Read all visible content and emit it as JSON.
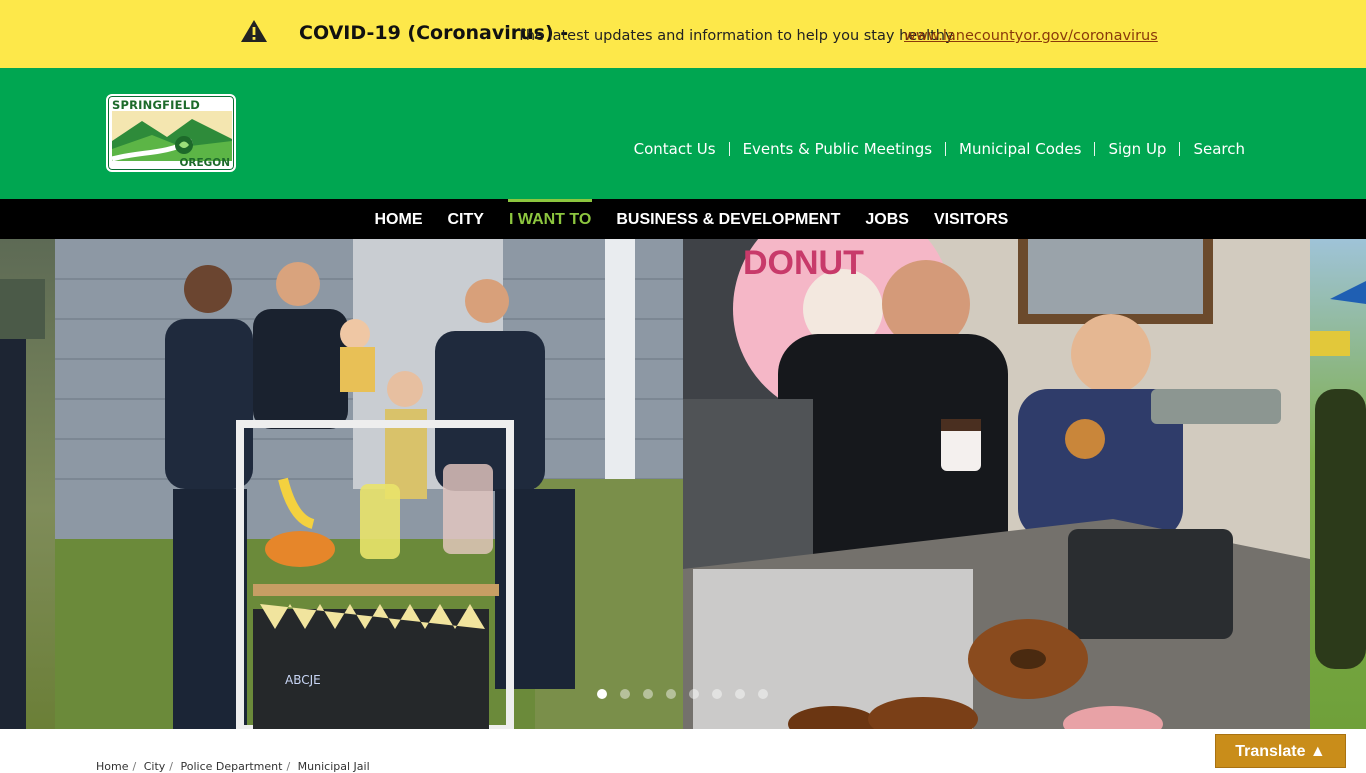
{
  "alert": {
    "icon": "warning-icon",
    "title": "COVID-19 (Coronavirus) -",
    "text": "The latest updates and information to help you stay healthy.",
    "link": "www.lanecountyor.gov/coronavirus",
    "background": "#fde84a"
  },
  "logo": {
    "top_text": "SPRINGFIELD",
    "bottom_text": "OREGON"
  },
  "utility_nav": [
    {
      "label": "Contact Us"
    },
    {
      "label": "Events & Public Meetings"
    },
    {
      "label": "Municipal Codes"
    },
    {
      "label": "Sign Up"
    },
    {
      "label": "Search"
    }
  ],
  "main_nav": [
    {
      "label": "HOME",
      "active": false
    },
    {
      "label": "CITY",
      "active": false
    },
    {
      "label": "I WANT TO",
      "active": true
    },
    {
      "label": "BUSINESS & DEVELOPMENT",
      "active": false
    },
    {
      "label": "JOBS",
      "active": false
    },
    {
      "label": "VISITORS",
      "active": false
    }
  ],
  "slider": {
    "dot_count": 8,
    "active_index": 0
  },
  "breadcrumb": [
    "Home",
    "City",
    "Police Department",
    "Municipal Jail"
  ],
  "translate": {
    "label": "Translate ▲"
  },
  "colors": {
    "header_green": "#00a651",
    "nav_black": "#000000",
    "active_nav": "#8dc63f",
    "translate_bg": "#c98d1a"
  }
}
